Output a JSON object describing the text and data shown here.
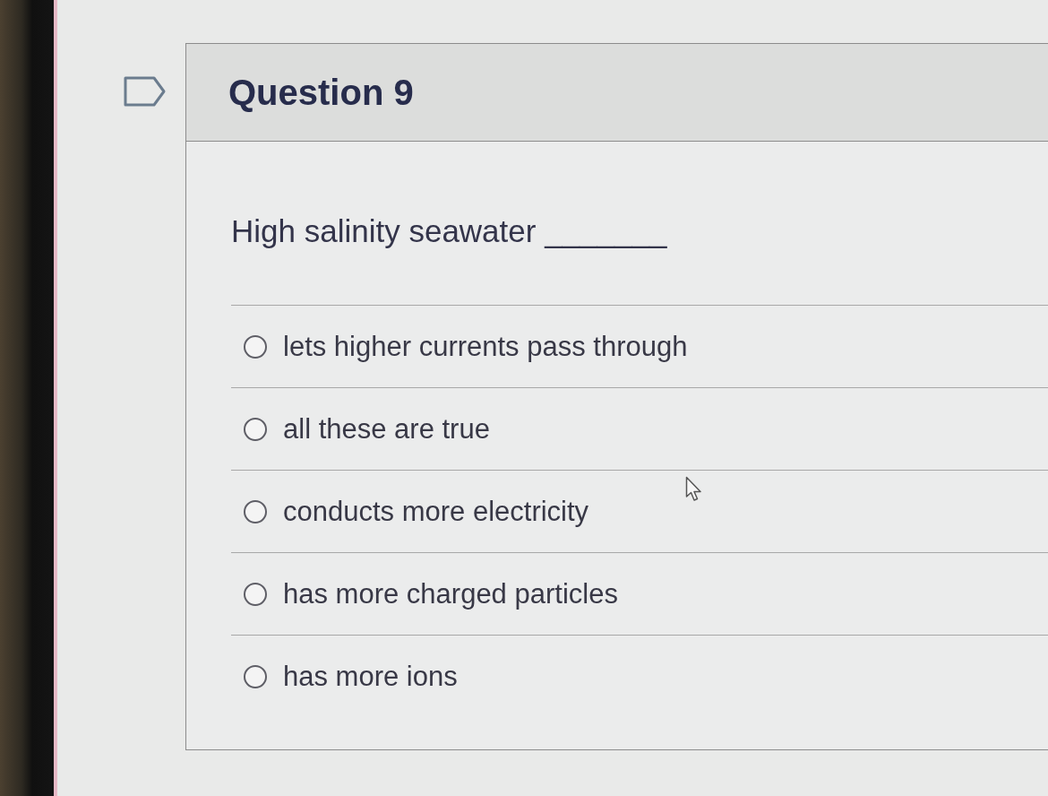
{
  "question": {
    "title": "Question 9",
    "flagged": false,
    "text": "High salinity seawater _______"
  },
  "options": [
    {
      "label": "lets higher currents pass through",
      "selected": false
    },
    {
      "label": "all these are true",
      "selected": false
    },
    {
      "label": "conducts more electricity",
      "selected": false
    },
    {
      "label": "has more charged particles",
      "selected": false
    },
    {
      "label": "has more ions",
      "selected": false
    }
  ]
}
